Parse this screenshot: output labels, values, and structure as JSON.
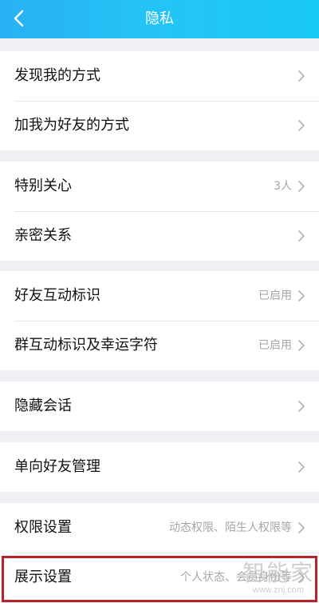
{
  "header": {
    "title": "隐私",
    "back_icon": "chevron-left-icon",
    "colors": {
      "start": "#29b1f3",
      "end": "#18c8f5"
    }
  },
  "groups": [
    {
      "rows": [
        {
          "label": "发现我的方式",
          "value": ""
        },
        {
          "label": "加我为好友的方式",
          "value": ""
        }
      ]
    },
    {
      "rows": [
        {
          "label": "特别关心",
          "value": "3人"
        },
        {
          "label": "亲密关系",
          "value": ""
        }
      ]
    },
    {
      "rows": [
        {
          "label": "好友互动标识",
          "value": "已启用"
        },
        {
          "label": "群互动标识及幸运字符",
          "value": "已启用"
        }
      ]
    },
    {
      "rows": [
        {
          "label": "隐藏会话",
          "value": ""
        }
      ]
    },
    {
      "rows": [
        {
          "label": "单向好友管理",
          "value": ""
        }
      ]
    },
    {
      "rows": [
        {
          "label": "权限设置",
          "value": "动态权限、陌生人权限等"
        },
        {
          "label": "展示设置",
          "value": "个人状态、会员身份等"
        }
      ]
    }
  ],
  "highlight_color": "#b8232a",
  "watermark": {
    "text": "智能家",
    "url": "www.znj.com"
  }
}
